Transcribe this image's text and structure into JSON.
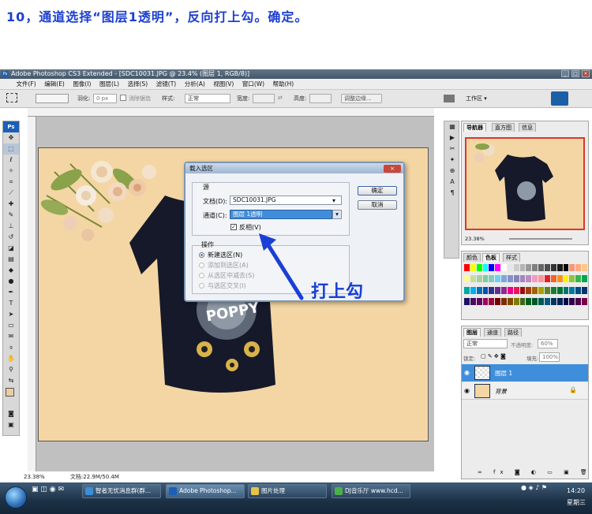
{
  "instruction": "10，通道选择“图层1透明”，反向打上勾。确定。",
  "window": {
    "title": "Adobe Photoshop CS3 Extended - [SDC10031.JPG @ 23.4% (图层 1, RGB/8)]",
    "minimize": "_",
    "maximize": "□",
    "close": "×"
  },
  "menu": [
    "文件(F)",
    "编辑(E)",
    "图像(I)",
    "图层(L)",
    "选择(S)",
    "滤镜(T)",
    "分析(A)",
    "视图(V)",
    "窗口(W)",
    "帮助(H)"
  ],
  "options": {
    "feather_label": "羽化:",
    "feather_value": "0 px",
    "antialias_label": "消除锯齿",
    "style_label": "样式:",
    "style_value": "正常",
    "width_label": "宽度:",
    "height_label": "高度:",
    "refine_button": "调整边缘...",
    "workspace_label": "工作区 ▾"
  },
  "status": {
    "zoom": "23.38%",
    "doc": "文档:22.9M/50.4M"
  },
  "dialog": {
    "title": "载入选区",
    "source_group": "源",
    "doc_label": "文档(D):",
    "doc_value": "SDC10031.JPG",
    "channel_label": "通道(C):",
    "channel_value": "图层 1透明",
    "invert_label": "反相(V)",
    "invert_checked": true,
    "ok_button": "确定",
    "cancel_button": "取消",
    "operation_group": "操作",
    "op_new": "新建选区(N)",
    "op_add": "添加到选区(A)",
    "op_subtract": "从选区中减去(S)",
    "op_intersect": "与选区交叉(I)"
  },
  "annotation": {
    "text": "打上勾",
    "color": "#1a3fd6"
  },
  "navigator": {
    "tabs": [
      "导航器",
      "直方图",
      "信息"
    ],
    "zoom": "23.38%"
  },
  "swatches": {
    "tabs": [
      "颜色",
      "色板",
      "样式"
    ]
  },
  "layers": {
    "tabs": [
      "图层",
      "通道",
      "路径"
    ],
    "blend_mode": "正常",
    "opacity_label": "不透明度:",
    "opacity_value": "60%",
    "lock_label": "锁定:",
    "fill_label": "填充:",
    "fill_value": "100%",
    "items": [
      {
        "name": "图层 1",
        "selected": true
      },
      {
        "name": "背景",
        "selected": false,
        "italic": true
      }
    ]
  },
  "taskbar": {
    "tasks": [
      "智者无忧消息群(群...",
      "Adobe Photoshop...",
      "图片处理",
      "DJ音乐厅 www.hcd..."
    ],
    "time": "14:20",
    "day": "星期三"
  },
  "colors": {
    "accent": "#1a3fd6",
    "canvas": "#f4d6a4",
    "shirt": "#15192a",
    "selection": "#3f8edc"
  }
}
